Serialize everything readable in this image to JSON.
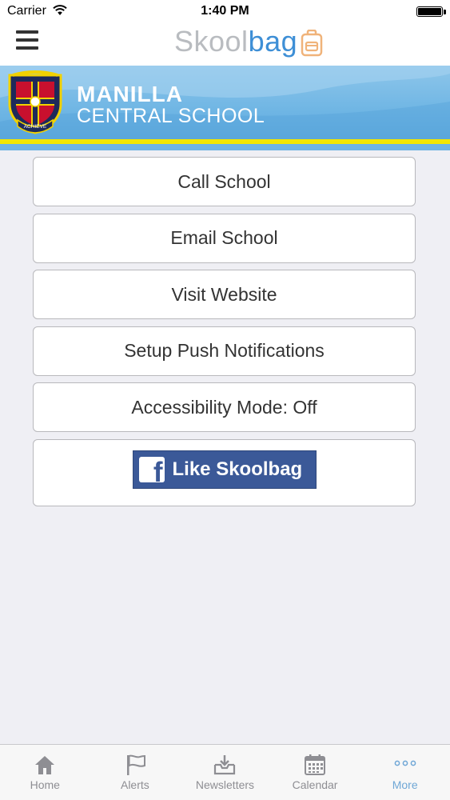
{
  "status_bar": {
    "carrier": "Carrier",
    "time": "1:40 PM"
  },
  "nav": {
    "brand_part1": "Skool",
    "brand_part2": "bag",
    "menu_icon": "hamburger-menu-icon",
    "brand_icon": "backpack-icon"
  },
  "school": {
    "name_line1": "MANILLA",
    "name_line2": "CENTRAL SCHOOL",
    "crest_motto": "ACHIEVE"
  },
  "actions": [
    {
      "label": "Call School"
    },
    {
      "label": "Email School"
    },
    {
      "label": "Visit Website"
    },
    {
      "label": "Setup Push Notifications"
    },
    {
      "label": "Accessibility Mode: Off"
    }
  ],
  "facebook": {
    "label": "Like Skoolbag",
    "icon": "facebook-icon",
    "color": "#3b5998"
  },
  "tabs": [
    {
      "label": "Home",
      "icon": "home-icon"
    },
    {
      "label": "Alerts",
      "icon": "flag-icon"
    },
    {
      "label": "Newsletters",
      "icon": "inbox-download-icon"
    },
    {
      "label": "Calendar",
      "icon": "calendar-icon"
    },
    {
      "label": "More",
      "icon": "more-dots-icon",
      "active": true
    }
  ],
  "colors": {
    "accent": "#3e8fd6",
    "banner": "#6eb5e4",
    "banner_stripe": "#f2e600",
    "active_tab": "#6fa7d6"
  }
}
